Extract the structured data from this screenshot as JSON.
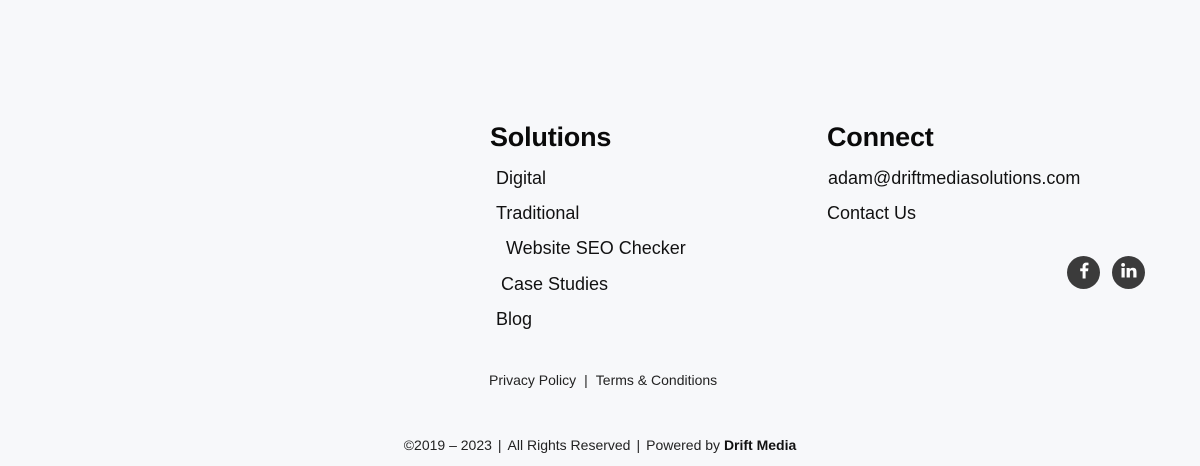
{
  "solutions": {
    "title": "Solutions",
    "links": [
      {
        "label": "Digital"
      },
      {
        "label": "Traditional"
      },
      {
        "label": "Website SEO Checker"
      },
      {
        "label": "Case Studies"
      },
      {
        "label": "Blog"
      }
    ]
  },
  "connect": {
    "title": "Connect",
    "email": "adam@driftmediasolutions.com",
    "contact_label": "Contact Us"
  },
  "social": [
    {
      "icon": "facebook-icon",
      "color": "#3b3b3b"
    },
    {
      "icon": "linkedin-icon",
      "color": "#3b3b3b"
    }
  ],
  "legal": {
    "privacy_label": "Privacy Policy",
    "separator": "|",
    "terms_label": "Terms & Conditions"
  },
  "copyright": {
    "years": "©2019 – 2023",
    "separator": "|",
    "rights": "All Rights Reserved",
    "powered_prefix": "Powered by",
    "brand": "Drift Media"
  },
  "colors": {
    "background": "#f7f8fa",
    "text": "#111111",
    "icon_circle": "#3b3b3b"
  }
}
